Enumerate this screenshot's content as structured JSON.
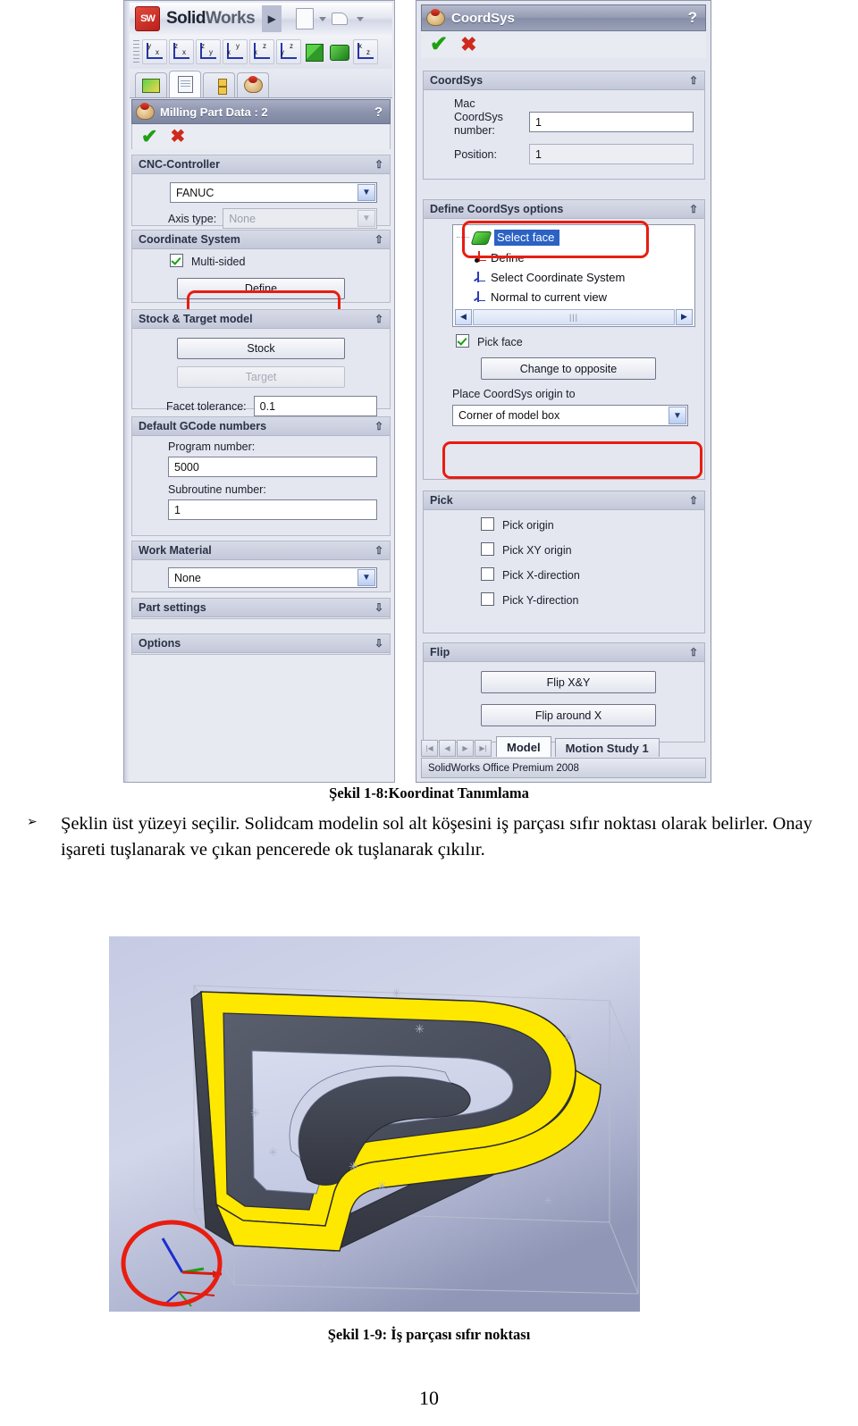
{
  "figure_top": {
    "solidworks": {
      "brand_bold": "Solid",
      "brand_light": "Works",
      "view_buttons": [
        {
          "name": "front-view",
          "labels": [
            "y",
            "x"
          ]
        },
        {
          "name": "top-view",
          "labels": [
            "z",
            "x"
          ]
        },
        {
          "name": "right-view",
          "labels": [
            "z",
            "y"
          ]
        },
        {
          "name": "back-view",
          "labels": [
            "y",
            "x"
          ]
        },
        {
          "name": "bottom-view",
          "labels": [
            "z",
            "x"
          ]
        },
        {
          "name": "left-view",
          "labels": [
            "z",
            "y"
          ]
        },
        {
          "name": "isometric-view",
          "labels": []
        },
        {
          "name": "shaded-view",
          "labels": []
        },
        {
          "name": "normal-to-view",
          "labels": [
            "x",
            "z"
          ]
        }
      ],
      "tree_tabs": [
        "feature-manager",
        "property-manager",
        "configuration-manager",
        "solidcam-manager"
      ],
      "dialog": {
        "title": "Milling Part Data : 2",
        "help": "?",
        "accept": "accept-check",
        "cancel": "cancel-cross",
        "groups": [
          {
            "title": "CNC-Controller",
            "chevron": "collapse",
            "controller_value": "FANUC",
            "axis_type_label": "Axis type:",
            "axis_type_value": "None"
          },
          {
            "title": "Coordinate System",
            "chevron": "collapse",
            "multi_sided_label": "Multi-sided",
            "multi_sided_checked": true,
            "define_button": "Define"
          },
          {
            "title": "Stock & Target model",
            "chevron": "collapse",
            "stock_button": "Stock",
            "target_button": "Target",
            "facet_label": "Facet tolerance:",
            "facet_value": "0.1"
          },
          {
            "title": "Default GCode numbers",
            "chevron": "collapse",
            "program_label": "Program number:",
            "program_value": "5000",
            "subroutine_label": "Subroutine number:",
            "subroutine_value": "1"
          },
          {
            "title": "Work Material",
            "chevron": "collapse",
            "material_value": "None"
          },
          {
            "title": "Part settings",
            "chevron": "expand"
          },
          {
            "title": "Options",
            "chevron": "expand"
          }
        ]
      }
    },
    "coordsys": {
      "title": "CoordSys",
      "help": "?",
      "accept": "accept-check",
      "cancel": "cancel-cross",
      "group_coordsys": {
        "title": "CoordSys",
        "chevron": "collapse",
        "mac_label": "Mac CoordSys number:",
        "mac_value": "1",
        "position_label": "Position:",
        "position_value": "1"
      },
      "group_define": {
        "title": "Define CoordSys options",
        "chevron": "collapse",
        "options": [
          {
            "label": "Select face",
            "icon": "green-face-icon",
            "selected": true
          },
          {
            "label": "Define",
            "icon": "origin-axes-icon",
            "selected": false
          },
          {
            "label": "Select Coordinate System",
            "icon": "coord-axes-icon",
            "selected": false
          },
          {
            "label": "Normal to current view",
            "icon": "coord-axes-icon",
            "selected": false
          }
        ],
        "pick_face_label": "Pick face",
        "pick_face_checked": true,
        "change_opposite_button": "Change to opposite",
        "place_origin_label": "Place CoordSys origin to",
        "place_origin_value": "Corner of model box"
      },
      "group_pick": {
        "title": "Pick",
        "chevron": "collapse",
        "items": [
          {
            "label": "Pick origin",
            "checked": false
          },
          {
            "label": "Pick XY origin",
            "checked": false
          },
          {
            "label": "Pick X-direction",
            "checked": false
          },
          {
            "label": "Pick Y-direction",
            "checked": false
          }
        ]
      },
      "group_flip": {
        "title": "Flip",
        "chevron": "collapse",
        "flip_xy_button": "Flip  X&Y",
        "flip_x_button": "Flip around X"
      },
      "bottom_tabs": [
        {
          "label": "Model",
          "active": true
        },
        {
          "label": "Motion Study 1",
          "active": false
        }
      ],
      "status_bar": "SolidWorks Office Premium 2008"
    }
  },
  "caption_1": "Şekil 1-8:Koordinat Tanımlama",
  "paragraph": {
    "bullet": "➢",
    "text": "Şeklin üst yüzeyi seçilir. Solidcam modelin sol alt köşesini iş parçası sıfır noktası olarak belirler. Onay işareti tuşlanarak ve çıkan pencerede ok tuşlanarak çıkılır."
  },
  "caption_2": "Şekil 1-9: İş parçası sıfır noktası",
  "page_number": "10",
  "colors": {
    "highlight_ring": "#e81d10",
    "model_yellow": "#ffe800",
    "model_dark": "#4a4e5c",
    "model_light": "#ccd2e8",
    "selection_blue": "#2b62c4"
  }
}
